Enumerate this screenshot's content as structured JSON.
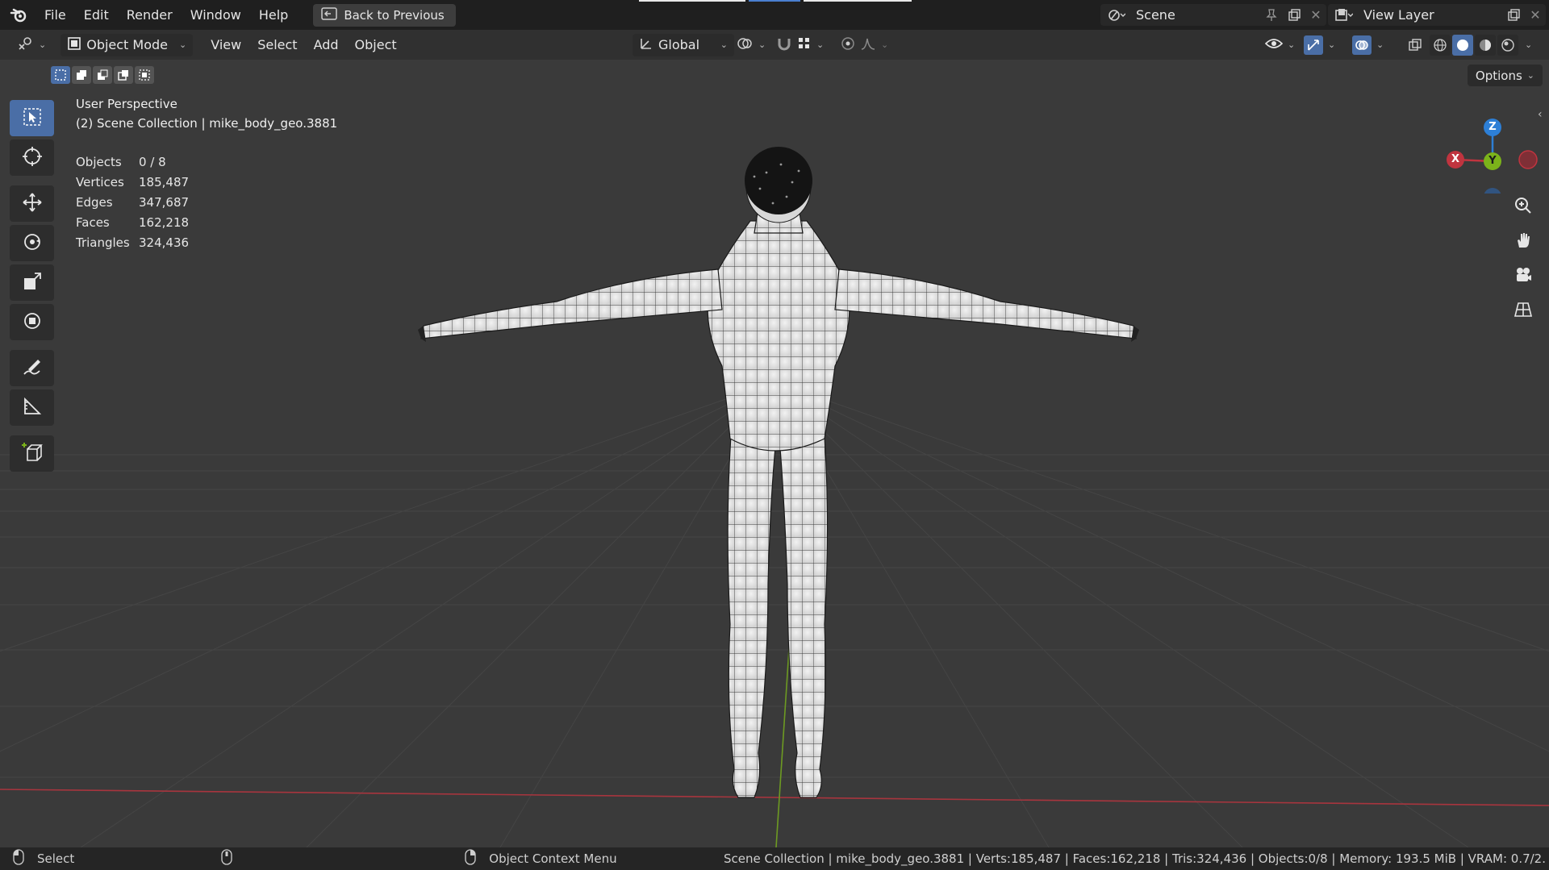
{
  "menu": {
    "items": [
      "File",
      "Edit",
      "Render",
      "Window",
      "Help"
    ],
    "back_button": "Back to Previous"
  },
  "scene": {
    "label": "Scene",
    "view_layer": "View Layer"
  },
  "header": {
    "mode": "Object Mode",
    "items": [
      "View",
      "Select",
      "Add",
      "Object"
    ],
    "orientation": "Global",
    "options": "Options"
  },
  "viewport": {
    "title": "User Perspective",
    "collection": "(2) Scene Collection | mike_body_geo.3881",
    "stats": [
      {
        "label": "Objects",
        "value": "0 / 8"
      },
      {
        "label": "Vertices",
        "value": "185,487"
      },
      {
        "label": "Edges",
        "value": "347,687"
      },
      {
        "label": "Faces",
        "value": "162,218"
      },
      {
        "label": "Triangles",
        "value": "324,436"
      }
    ]
  },
  "gizmo": {
    "x": "X",
    "y": "Y",
    "z": "Z"
  },
  "statusbar": {
    "left": "Select",
    "middle": "Object Context Menu",
    "right": "Scene Collection | mike_body_geo.3881 | Verts:185,487 | Faces:162,218 | Tris:324,436 | Objects:0/8 | Memory: 193.5 MiB | VRAM: 0.7/2."
  },
  "colors": {
    "accent": "#4a6ea6",
    "x_axis": "#c0343f",
    "y_axis": "#7bb31a",
    "z_axis": "#2d7fd6"
  }
}
